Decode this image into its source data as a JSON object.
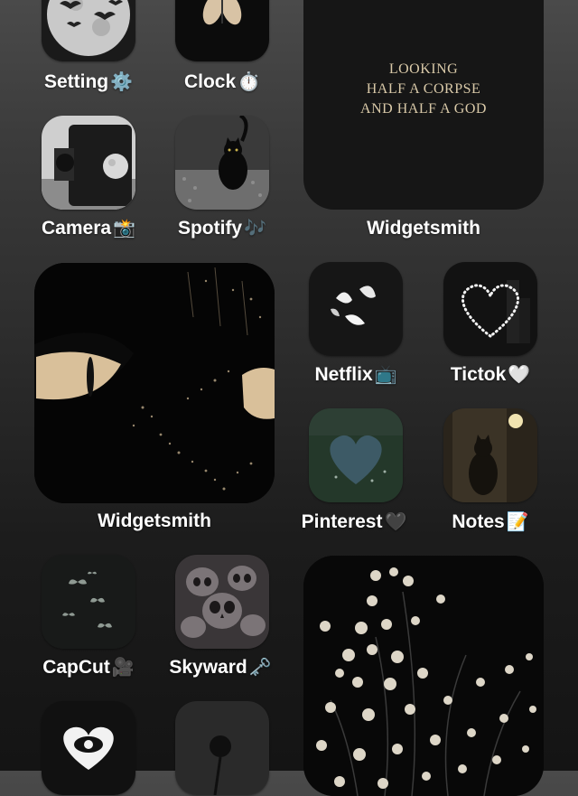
{
  "apps": {
    "setting": {
      "label": "Setting",
      "emoji": "⚙️"
    },
    "clock": {
      "label": "Clock",
      "emoji": "⏱️"
    },
    "camera": {
      "label": "Camera",
      "emoji": "📸"
    },
    "spotify": {
      "label": "Spotify",
      "emoji": "🎶"
    },
    "netflix": {
      "label": "Netflix",
      "emoji": "📺"
    },
    "tictok": {
      "label": "Tictok",
      "emoji": "🤍"
    },
    "pinterest": {
      "label": "Pinterest",
      "emoji": "🖤"
    },
    "notes": {
      "label": "Notes",
      "emoji": "📝"
    },
    "capcut": {
      "label": "CapCut",
      "emoji": "🎥"
    },
    "skyward": {
      "label": "Skyward",
      "emoji": "🗝️"
    }
  },
  "widgets": {
    "quote_widget": {
      "label": "Widgetsmith",
      "lines": [
        "LOOKING",
        "HALF A CORPSE",
        "AND HALF A GOD"
      ]
    },
    "cat_widget": {
      "label": "Widgetsmith"
    }
  }
}
